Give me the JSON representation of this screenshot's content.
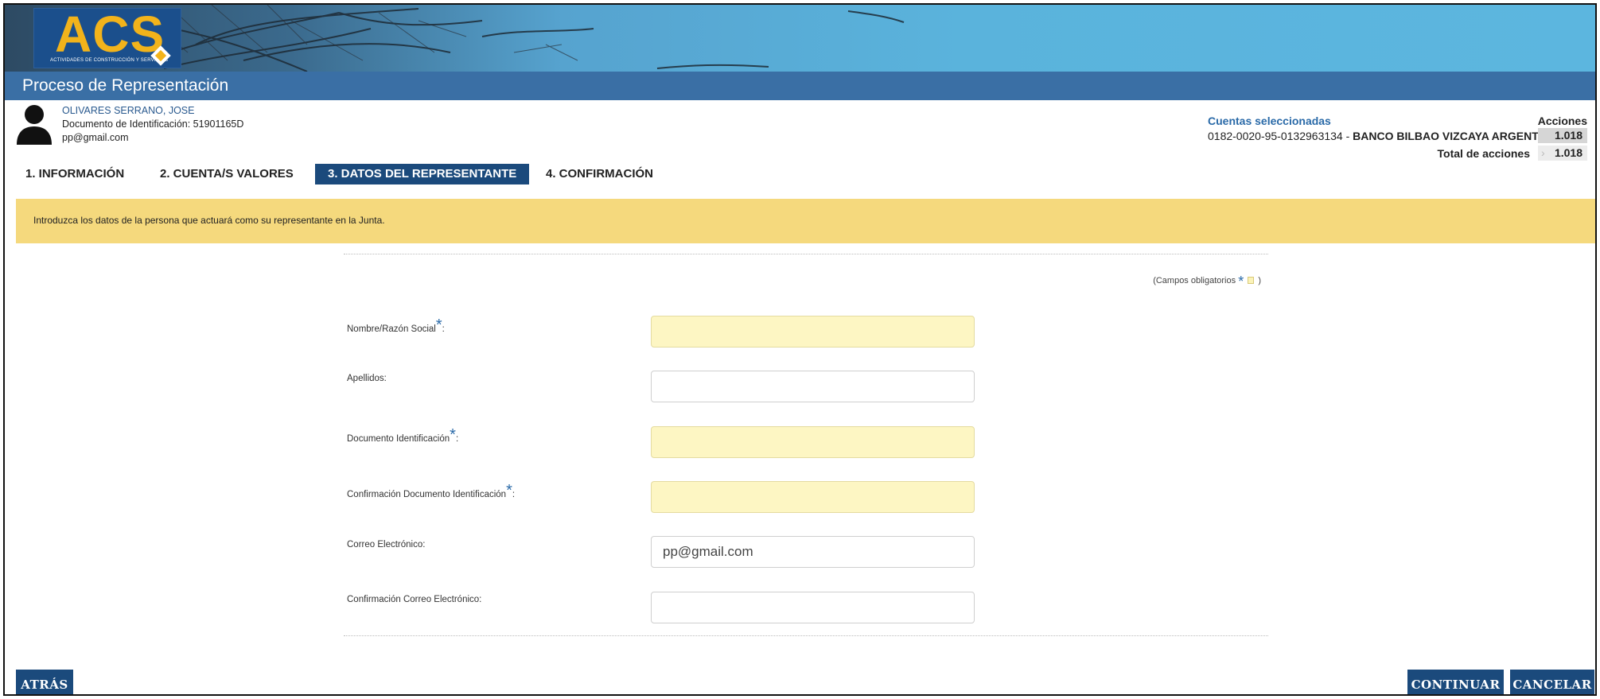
{
  "logo": {
    "text": "ACS",
    "subtitle": "ACTIVIDADES DE CONSTRUCCIÓN Y SERVICIOS"
  },
  "header": {
    "title": "Proceso de Representación"
  },
  "user": {
    "name": "OLIVARES SERRANO, JOSE",
    "document": "Documento de Identificación: 51901165D",
    "email": "pp@gmail.com"
  },
  "accounts": {
    "title": "Cuentas seleccionadas",
    "account_number": "0182-0020-95-0132963134 -",
    "bank": "BANCO BILBAO VIZCAYA ARGENTA...",
    "acciones_label": "Acciones",
    "acciones_value": "1.018",
    "total_label": "Total de acciones",
    "total_value": "1.018"
  },
  "steps": [
    {
      "label": "1. INFORMACIÓN",
      "active": false
    },
    {
      "label": "2. CUENTA/S VALORES",
      "active": false
    },
    {
      "label": "3. DATOS DEL REPRESENTANTE",
      "active": true
    },
    {
      "label": "4. CONFIRMACIÓN",
      "active": false
    }
  ],
  "notice": "Introduzca los datos de la persona que actuará como su representante en la Junta.",
  "required_note": {
    "prefix": "(Campos obligatorios",
    "star": "*",
    "suffix": ")"
  },
  "form": {
    "fields": [
      {
        "label": "Nombre/Razón Social",
        "required": true,
        "value": "",
        "colon": ":"
      },
      {
        "label": "Apellidos:",
        "required": false,
        "value": ""
      },
      {
        "label": "Documento Identificación",
        "required": true,
        "value": "",
        "colon": ":"
      },
      {
        "label": "Confirmación Documento Identificación",
        "required": true,
        "value": "",
        "colon": ":"
      },
      {
        "label": "Correo Electrónico:",
        "required": false,
        "value": "pp@gmail.com"
      },
      {
        "label": "Confirmación Correo Electrónico:",
        "required": false,
        "value": ""
      }
    ]
  },
  "buttons": {
    "back": "ATRÁS",
    "continue": "CONTINUAR",
    "cancel": "CANCELAR"
  },
  "colors": {
    "primary": "#1b4a7c",
    "title_bar": "#3a6fa5",
    "notice_bg": "#f5d97d",
    "required_field_bg": "#fdf6c3",
    "accent_link": "#2a6aa8",
    "logo_yellow": "#f2b31b"
  }
}
